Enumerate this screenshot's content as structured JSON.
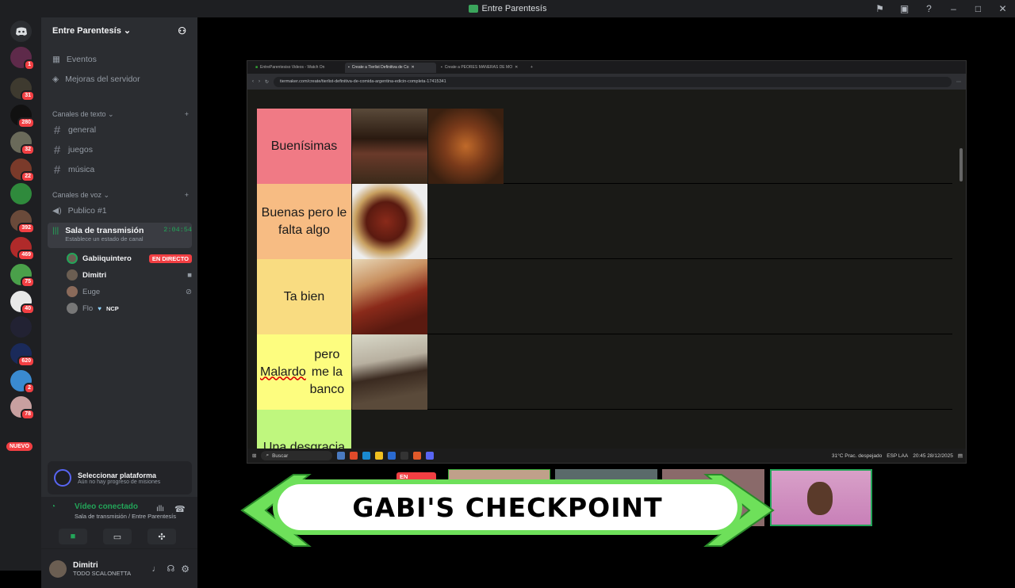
{
  "window": {
    "title": "Entre Parentesís"
  },
  "guild": {
    "name": "Entre Parentesís",
    "links": [
      {
        "label": "Eventos",
        "icon": "calendar-icon"
      },
      {
        "label": "Mejoras del servidor",
        "icon": "boost-icon"
      }
    ],
    "text_category": "Canales de texto",
    "text_channels": [
      "general",
      "juegos",
      "música"
    ],
    "voice_category": "Canales de voz",
    "voice_channels": [
      {
        "name": "Publico #1"
      },
      {
        "name": "Sala de transmisión",
        "timer": "2:04:54",
        "status": "Establece un estado de canal"
      }
    ],
    "voice_users": [
      {
        "name": "Gabiiquintero",
        "live": "EN DIRECTO"
      },
      {
        "name": "Dimitri"
      },
      {
        "name": "Euge"
      },
      {
        "name": "Flo",
        "tag": "NCP"
      }
    ]
  },
  "server_badges": [
    "1",
    "31",
    "280",
    "32",
    "22",
    "392",
    "469",
    "75",
    "40",
    "620",
    "2",
    "78",
    "63"
  ],
  "server_new": "NUEVO",
  "platform": {
    "title": "Seleccionar plataforma",
    "subtitle": "Aún no hay progreso de misiones"
  },
  "voice": {
    "status": "Vídeo conectado",
    "location": "Sala de transmisión / Entre Parentesís"
  },
  "user": {
    "name": "Dimitri",
    "status": "TODO SCALONETTA"
  },
  "browser": {
    "tabs": [
      "EntreParentesiso Videos - Watch On",
      "Create a Tierlist Definitiva de Co",
      "Create a PEORES MANERAS DE MO"
    ],
    "url": "tiermaker.com/create/tierlist-definitiva-de-comida-argentina-edicin-completa-17415341"
  },
  "tiers": [
    {
      "label": "Buenísimas",
      "color": "#f07a85",
      "items": 2
    },
    {
      "label": "Buenas pero le falta algo",
      "color": "#f7bc83",
      "items": 1
    },
    {
      "label": "Ta bien",
      "color": "#f9dc81",
      "items": 1
    },
    {
      "label": "Malardo pero me la banco",
      "color": "#fdfd7f",
      "items": 1
    },
    {
      "label": "Una desgracia",
      "color": "#bff77e",
      "items": 0
    }
  ],
  "taskbar": {
    "search": "Buscar",
    "weather": "31°C  Prac. despejado",
    "lang": "ESP LAA",
    "time": "20:45",
    "date": "28/12/2025"
  },
  "stream_overlay": {
    "title": "GABI'S CHECKPOINT",
    "live_badge": "EN DIRECTO"
  }
}
